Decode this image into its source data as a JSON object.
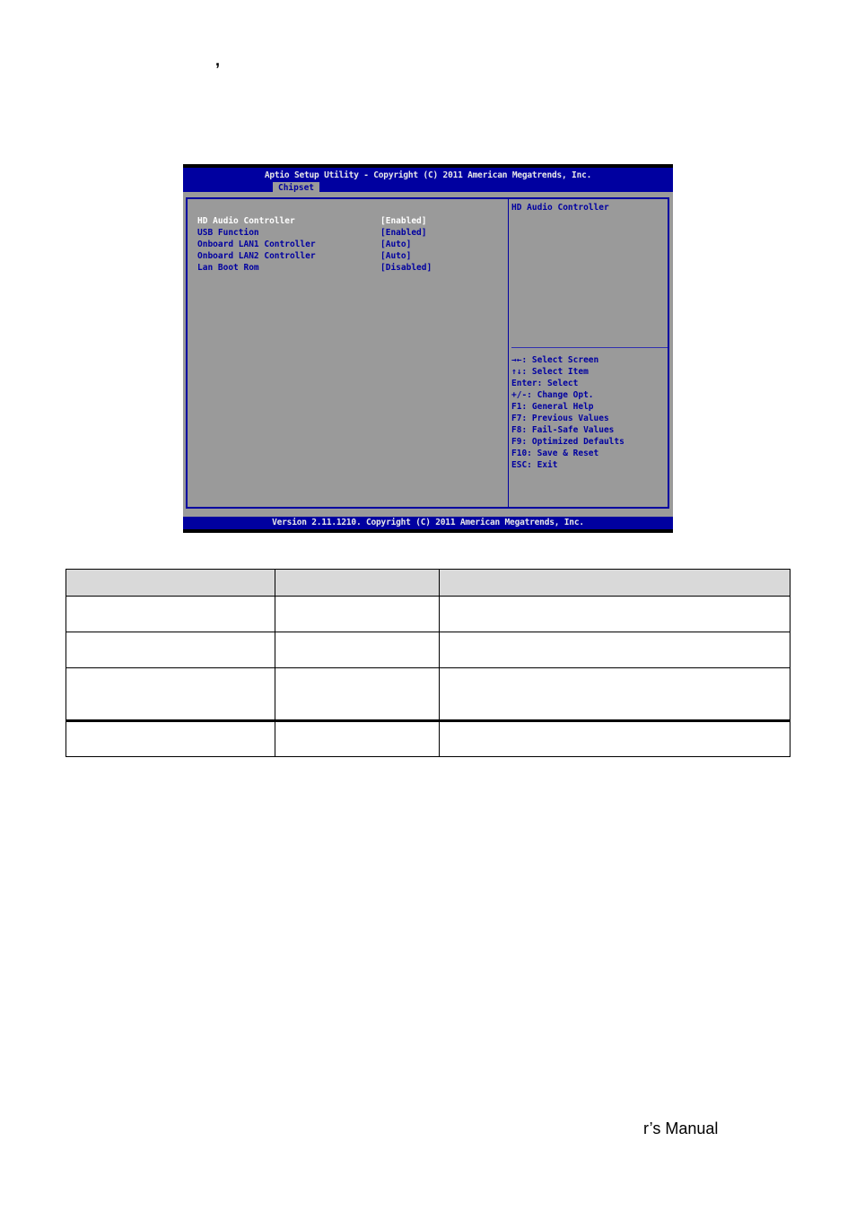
{
  "page": {
    "stray_text": ",",
    "footer_text": "r’s Manual"
  },
  "bios": {
    "title": "Aptio Setup Utility - Copyright (C) 2011 American Megatrends, Inc.",
    "active_tab": "Chipset",
    "items": [
      {
        "label": "HD Audio Controller",
        "value": "[Enabled]",
        "selected": true
      },
      {
        "label": "USB Function",
        "value": "[Enabled]",
        "selected": false
      },
      {
        "label": "Onboard LAN1 Controller",
        "value": "[Auto]",
        "selected": false
      },
      {
        "label": "Onboard LAN2 Controller",
        "value": "[Auto]",
        "selected": false
      },
      {
        "label": "Lan Boot Rom",
        "value": "[Disabled]",
        "selected": false
      }
    ],
    "help_text": "HD Audio Controller",
    "key_legend": [
      "→←: Select Screen",
      "↑↓: Select Item",
      "Enter: Select",
      "+/-: Change Opt.",
      "F1: General Help",
      "F7: Previous Values",
      "F8: Fail-Safe Values",
      "F9: Optimized Defaults",
      "F10: Save & Reset",
      "ESC: Exit"
    ],
    "footer": "Version 2.11.1210. Copyright (C) 2011 American Megatrends, Inc.",
    "colors": {
      "header_blue": "#0000a0",
      "panel_gray": "#9a9a9a",
      "selected_text": "#ffffff"
    }
  },
  "table": {
    "headers": [
      "",
      "",
      ""
    ],
    "rows": [
      [
        "",
        "",
        ""
      ],
      [
        "",
        "",
        ""
      ],
      [
        "",
        "",
        ""
      ],
      [
        "",
        "",
        ""
      ]
    ]
  }
}
